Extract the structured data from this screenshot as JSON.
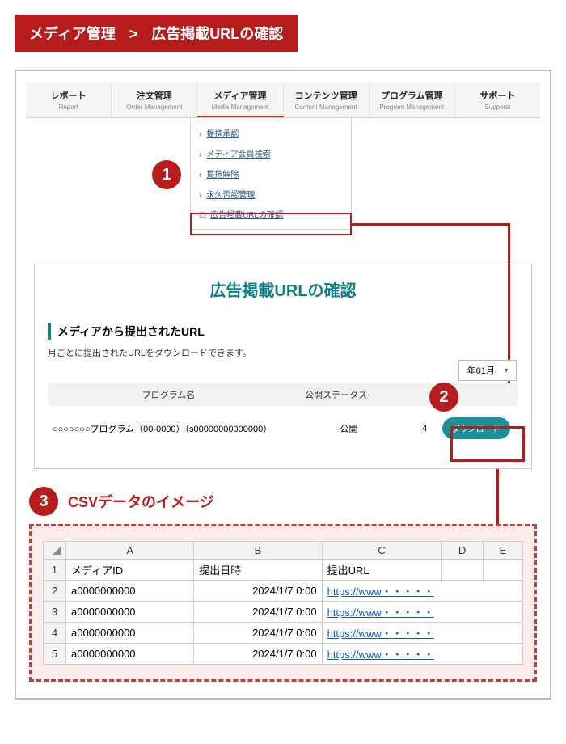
{
  "breadcrumb": {
    "a": "メディア管理",
    "sep": ">",
    "b": "広告掲載URLの確認"
  },
  "tabs": [
    {
      "jp": "レポート",
      "en": "Report"
    },
    {
      "jp": "注文管理",
      "en": "Order Management"
    },
    {
      "jp": "メディア管理",
      "en": "Media Management"
    },
    {
      "jp": "コンテンツ管理",
      "en": "Content Management"
    },
    {
      "jp": "プログラム管理",
      "en": "Program Management"
    },
    {
      "jp": "サポート",
      "en": "Supports"
    }
  ],
  "dropdown": {
    "items": [
      "提携承認",
      "メディア会員検索",
      "提携解除",
      "永久否認管理",
      "広告掲載URLの確認"
    ]
  },
  "badges": {
    "one": "1",
    "two": "2",
    "three": "3"
  },
  "page_title": "広告掲載URLの確認",
  "section": {
    "head": "メディアから提出されたURL",
    "desc": "月ごとに提出されたURLをダウンロードできます。"
  },
  "select": {
    "value": "年01月"
  },
  "table": {
    "head": {
      "c1": "プログラム名",
      "c2": "公開ステータス"
    },
    "row": {
      "c1": "○○○○○○○プログラム（00-0000）（s00000000000000）",
      "c2": "公開",
      "c3": "4",
      "c4_btn": "ダウンロード"
    }
  },
  "csv": {
    "label": "CSVデータのイメージ",
    "cols": [
      "A",
      "B",
      "C",
      "D",
      "E"
    ],
    "header_row": {
      "num": "1",
      "a": "メディアID",
      "b": "提出日時",
      "c": "提出URL",
      "d": "",
      "e": ""
    },
    "rows": [
      {
        "num": "2",
        "a": "a0000000000",
        "b": "2024/1/7 0:00",
        "link": "https://www・・・・・"
      },
      {
        "num": "3",
        "a": "a0000000000",
        "b": "2024/1/7 0:00",
        "link": "https://www・・・・・"
      },
      {
        "num": "4",
        "a": "a0000000000",
        "b": "2024/1/7 0:00",
        "link": "https://www・・・・・"
      },
      {
        "num": "5",
        "a": "a0000000000",
        "b": "2024/1/7 0:00",
        "link": "https://www・・・・・"
      }
    ]
  }
}
